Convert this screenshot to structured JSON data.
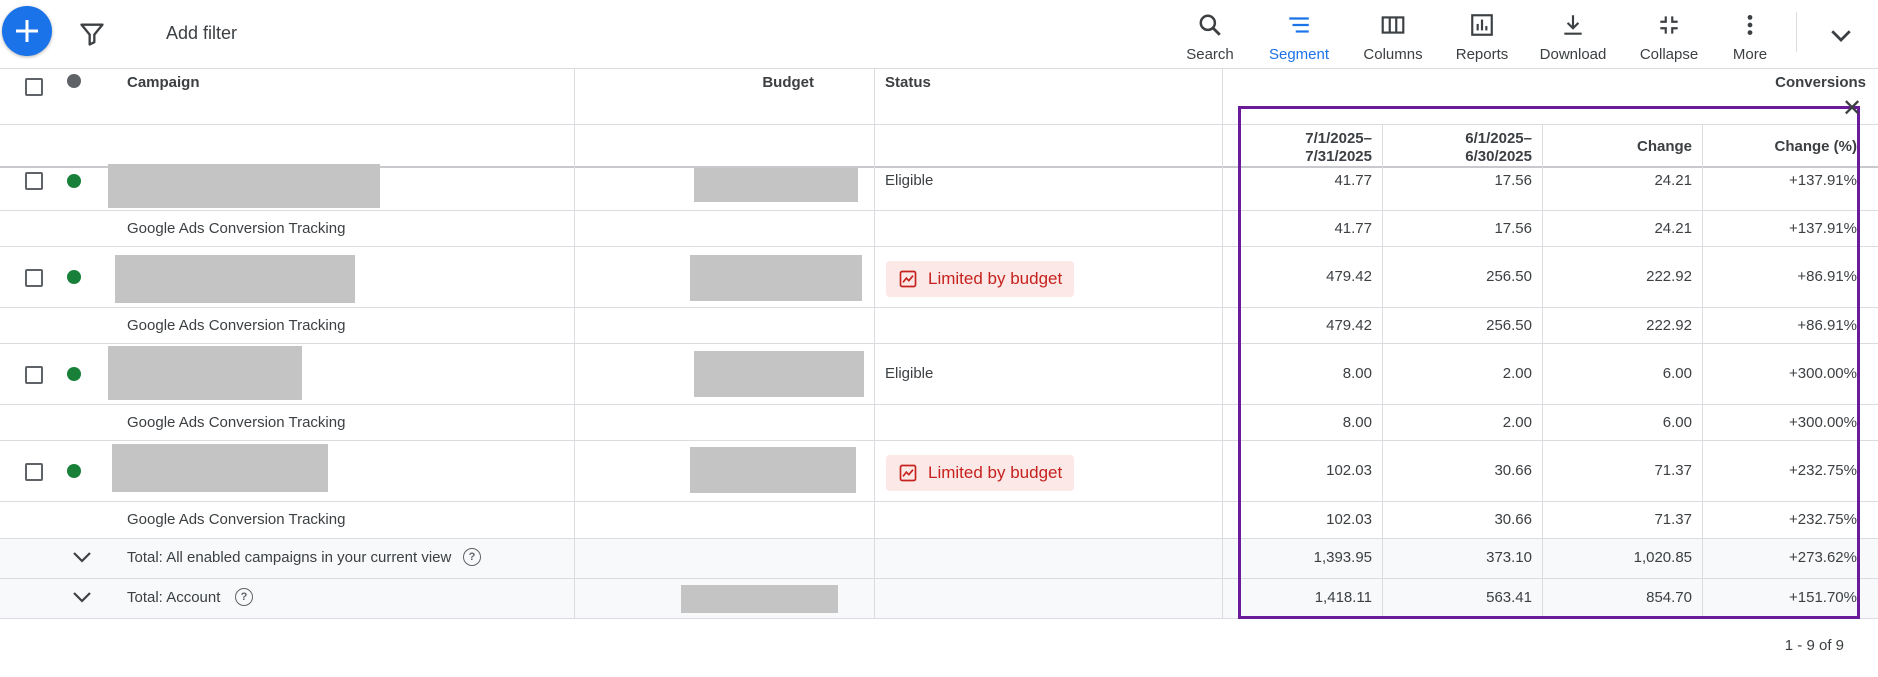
{
  "toolbar": {
    "add_filter": "Add filter",
    "tools": [
      {
        "label": "Search",
        "icon": "search-icon"
      },
      {
        "label": "Segment",
        "icon": "segment-icon",
        "active": true
      },
      {
        "label": "Columns",
        "icon": "columns-icon"
      },
      {
        "label": "Reports",
        "icon": "reports-icon"
      },
      {
        "label": "Download",
        "icon": "download-icon"
      },
      {
        "label": "Collapse",
        "icon": "collapse-icon"
      },
      {
        "label": "More",
        "icon": "more-vert-icon"
      }
    ]
  },
  "table": {
    "headers": {
      "campaign": "Campaign",
      "budget": "Budget",
      "status": "Status",
      "conversions": "Conversions"
    },
    "sub_headers": {
      "period1_line1": "7/1/2025–",
      "period1_line2": "7/31/2025",
      "period2_line1": "6/1/2025–",
      "period2_line2": "6/30/2025",
      "change": "Change",
      "change_pct": "Change (%)"
    },
    "rows": [
      {
        "status": "Eligible",
        "p1": "41.77",
        "p2": "17.56",
        "change": "24.21",
        "pct": "+137.91%"
      },
      {
        "label": "Google Ads Conversion Tracking",
        "p1": "41.77",
        "p2": "17.56",
        "change": "24.21",
        "pct": "+137.91%"
      },
      {
        "status": "Limited by budget",
        "p1": "479.42",
        "p2": "256.50",
        "change": "222.92",
        "pct": "+86.91%"
      },
      {
        "label": "Google Ads Conversion Tracking",
        "p1": "479.42",
        "p2": "256.50",
        "change": "222.92",
        "pct": "+86.91%"
      },
      {
        "status": "Eligible",
        "p1": "8.00",
        "p2": "2.00",
        "change": "6.00",
        "pct": "+300.00%"
      },
      {
        "label": "Google Ads Conversion Tracking",
        "p1": "8.00",
        "p2": "2.00",
        "change": "6.00",
        "pct": "+300.00%"
      },
      {
        "status": "Limited by budget",
        "p1": "102.03",
        "p2": "30.66",
        "change": "71.37",
        "pct": "+232.75%"
      },
      {
        "label": "Google Ads Conversion Tracking",
        "p1": "102.03",
        "p2": "30.66",
        "change": "71.37",
        "pct": "+232.75%"
      }
    ],
    "totals": [
      {
        "label": "Total: All enabled campaigns in your current view",
        "p1": "1,393.95",
        "p2": "373.10",
        "change": "1,020.85",
        "pct": "+273.62%"
      },
      {
        "label": "Total: Account",
        "p1": "1,418.11",
        "p2": "563.41",
        "change": "854.70",
        "pct": "+151.70%"
      }
    ]
  },
  "pager": "1 - 9 of 9",
  "colors": {
    "accent": "#1a73e8",
    "status_green": "#188038",
    "limited_red": "#c5221f",
    "limited_bg": "#fce8e6",
    "highlight": "#6a1b9a"
  }
}
